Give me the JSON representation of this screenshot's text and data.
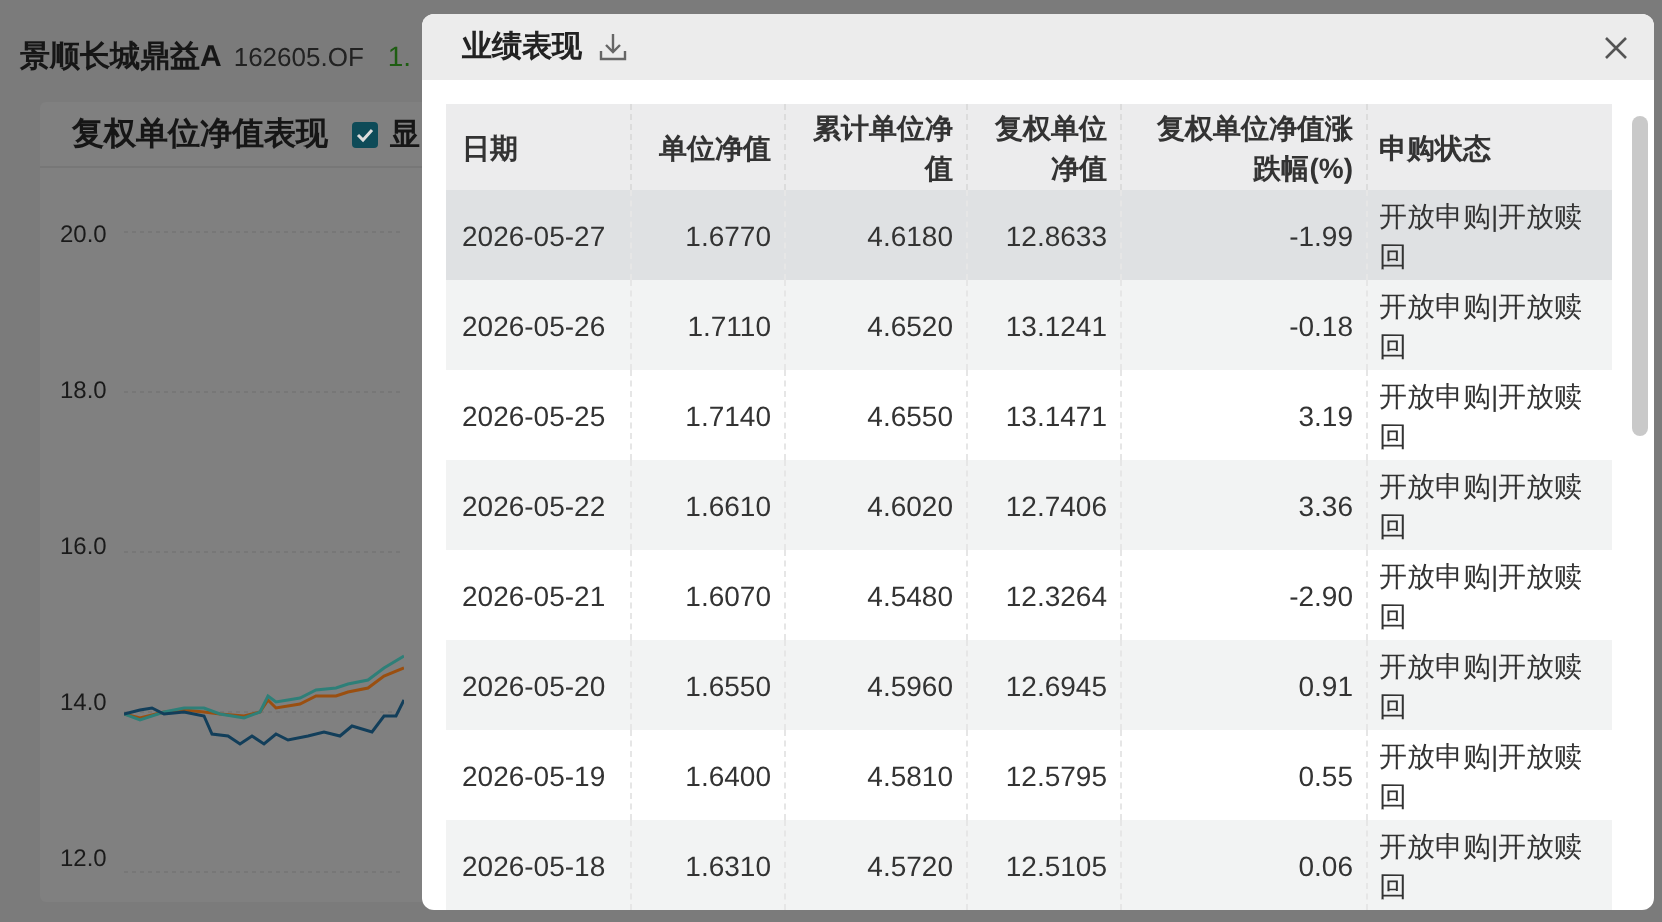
{
  "page": {
    "fund_name": "景顺长城鼎益A",
    "fund_code": "162605.OF",
    "nav_partial": "1.",
    "chart": {
      "title": "复权单位净值表现",
      "checkbox": {
        "label": "显",
        "checked": true
      },
      "y_labels": [
        "20.0",
        "18.0",
        "16.0",
        "14.0",
        "12.0"
      ]
    }
  },
  "dialog": {
    "title": "业绩表现",
    "columns": [
      {
        "label": "日期",
        "kind": "text"
      },
      {
        "label": "单位净值",
        "kind": "number"
      },
      {
        "label": "累计单位净值",
        "kind": "number"
      },
      {
        "label": "复权单位净值",
        "kind": "number"
      },
      {
        "label": "复权单位净值涨跌幅(%)",
        "kind": "number"
      },
      {
        "label": "申购状态",
        "kind": "text"
      }
    ],
    "rows": [
      {
        "selected": true,
        "cells": [
          "2026-05-27",
          "1.6770",
          "4.6180",
          "12.8633",
          "-1.99",
          "开放申购|开放赎回"
        ]
      },
      {
        "selected": false,
        "cells": [
          "2026-05-26",
          "1.7110",
          "4.6520",
          "13.1241",
          "-0.18",
          "开放申购|开放赎回"
        ]
      },
      {
        "selected": false,
        "cells": [
          "2026-05-25",
          "1.7140",
          "4.6550",
          "13.1471",
          "3.19",
          "开放申购|开放赎回"
        ]
      },
      {
        "selected": false,
        "cells": [
          "2026-05-22",
          "1.6610",
          "4.6020",
          "12.7406",
          "3.36",
          "开放申购|开放赎回"
        ]
      },
      {
        "selected": false,
        "cells": [
          "2026-05-21",
          "1.6070",
          "4.5480",
          "12.3264",
          "-2.90",
          "开放申购|开放赎回"
        ]
      },
      {
        "selected": false,
        "cells": [
          "2026-05-20",
          "1.6550",
          "4.5960",
          "12.6945",
          "0.91",
          "开放申购|开放赎回"
        ]
      },
      {
        "selected": false,
        "cells": [
          "2026-05-19",
          "1.6400",
          "4.5810",
          "12.5795",
          "0.55",
          "开放申购|开放赎回"
        ]
      },
      {
        "selected": false,
        "cells": [
          "2026-05-18",
          "1.6310",
          "4.5720",
          "12.5105",
          "0.06",
          "开放申购|开放赎回"
        ]
      }
    ]
  }
}
